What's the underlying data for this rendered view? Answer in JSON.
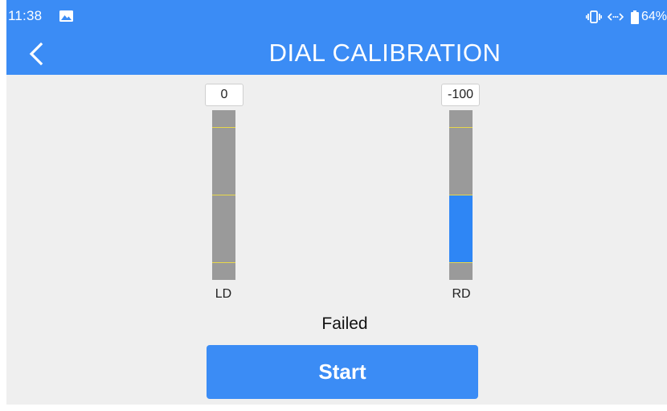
{
  "status_bar": {
    "time": "11:38",
    "battery": "64%",
    "icons": [
      "image-icon",
      "vibrate-icon",
      "link-icon",
      "battery-icon"
    ]
  },
  "header": {
    "title": "DIAL CALIBRATION",
    "back_icon": "chevron-left-icon"
  },
  "dials": [
    {
      "label": "LD",
      "value": "0",
      "fill_fraction": 0,
      "marks": [
        "upper",
        "center",
        "lower"
      ]
    },
    {
      "label": "RD",
      "value": "-100",
      "fill_fraction": 0.4,
      "marks": [
        "upper",
        "center",
        "lower"
      ]
    }
  ],
  "result": "Failed",
  "start_button": "Start",
  "colors": {
    "accent": "#3b8cf5",
    "bar": "#9a9a9a",
    "fill": "#2e86f5",
    "mark": "#e8d84a",
    "background": "#efefef"
  }
}
